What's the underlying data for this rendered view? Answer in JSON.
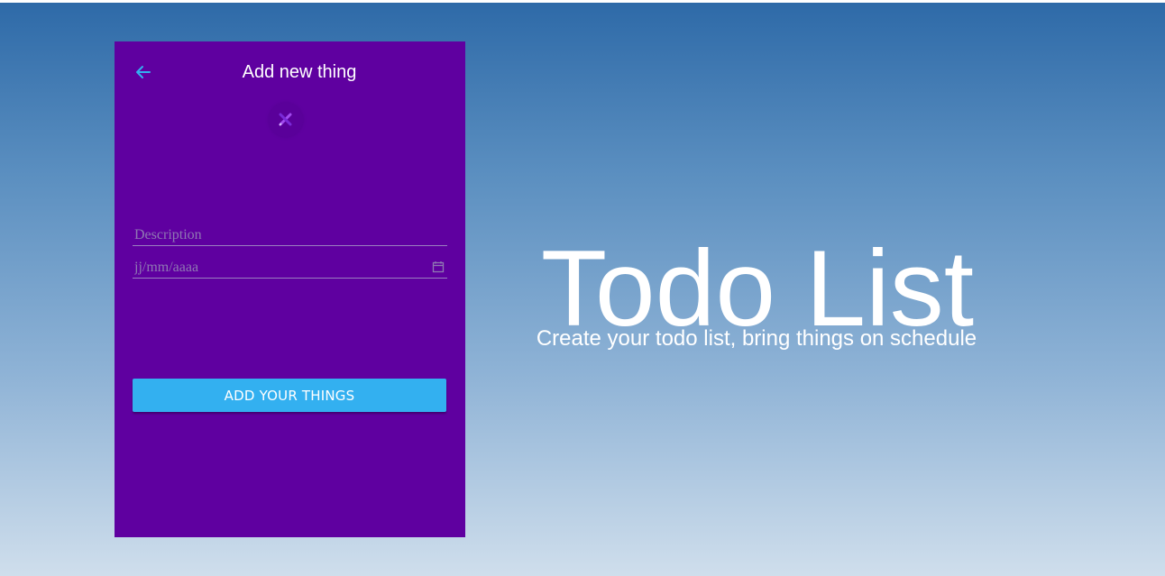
{
  "panel": {
    "title": "Add new thing",
    "back_icon": "arrow-left-icon",
    "tool_icon": "pencil-ruler-icon",
    "description_placeholder": "Description",
    "date_placeholder": "jj/mm/aaaa",
    "calendar_icon": "calendar-icon",
    "add_button_label": "ADD YOUR THINGS"
  },
  "hero": {
    "title": "Todo List",
    "subtitle": "Create your todo list, bring things on schedule"
  },
  "colors": {
    "panel_bg": "#5f00a0",
    "accent_button": "#33b0f0",
    "back_arrow": "#33b0f0",
    "gradient_top": "#2e6aa8",
    "gradient_bottom": "#cfdeec"
  }
}
